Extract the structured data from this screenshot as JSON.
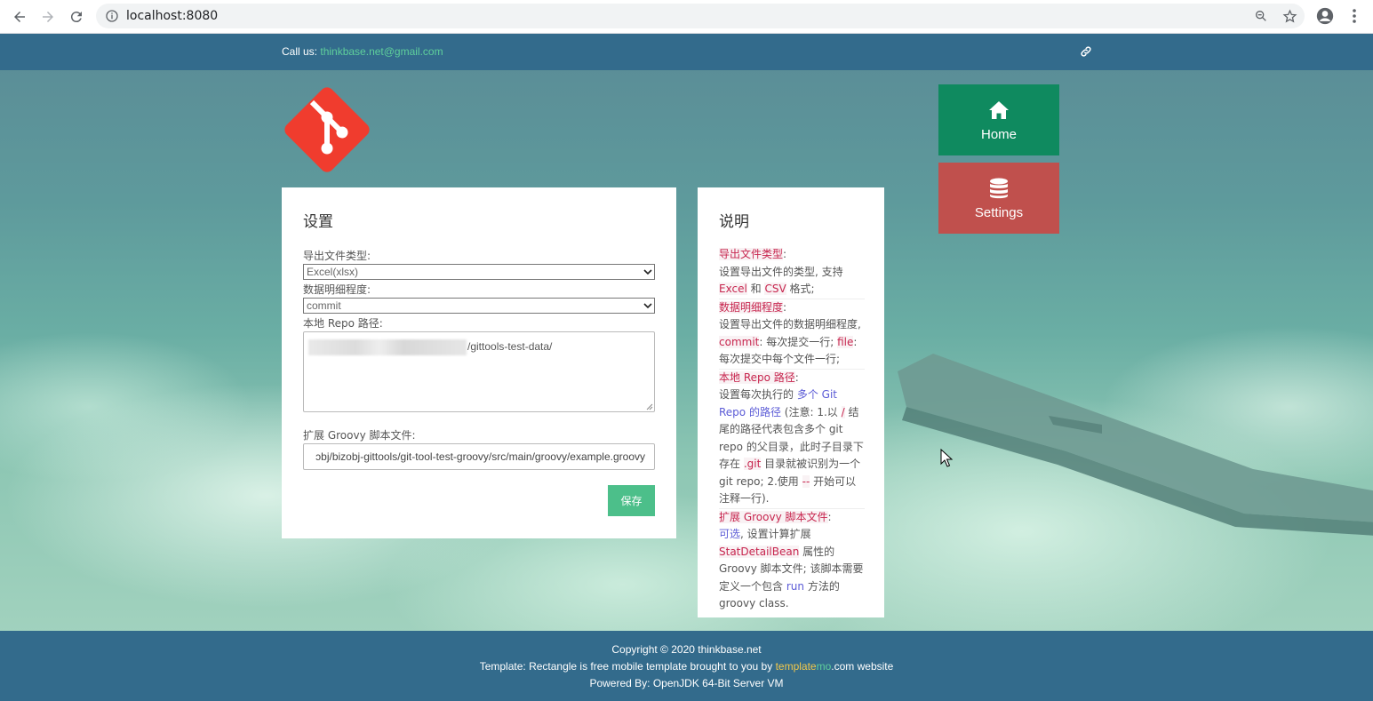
{
  "browser": {
    "url": "localhost:8080"
  },
  "topbar": {
    "callus_label": "Call us:",
    "email": "thinkbase.net@gmail.com"
  },
  "tiles": {
    "home_label": "Home",
    "settings_label": "Settings"
  },
  "settings": {
    "title": "设置",
    "export_type_label": "导出文件类型:",
    "export_type_value": "Excel(xlsx)",
    "detail_label": "数据明细程度:",
    "detail_value": "commit",
    "repo_label": "本地 Repo 路径:",
    "repo_value_visible": "/gittools-test-data/",
    "groovy_label": "扩展 Groovy 脚本文件:",
    "groovy_value": "ɔbj/bizobj-gittools/git-tool-test-groovy/src/main/groovy/example.groovy",
    "save_label": "保存"
  },
  "help": {
    "title": "说明",
    "s1_kw": "导出文件类型",
    "s1_colon": ":",
    "s1_text_a": "设置导出文件的类型, 支持",
    "s1_excel": "Excel",
    "s1_and": "和",
    "s1_csv": "CSV",
    "s1_fmt": "格式;",
    "s2_kw": "数据明细程度",
    "s2_colon": ":",
    "s2_text_a": "设置导出文件的数据明细程度,",
    "s2_commit": "commit",
    "s2_text_b": ": 每次提交一行;",
    "s2_file": "file",
    "s2_text_c": ": 每次提交中每个文件一行;",
    "s3_kw": "本地 Repo 路径",
    "s3_colon": ":",
    "s3_text_a": "设置每次执行的",
    "s3_multi": "多个 Git Repo 的路径",
    "s3_text_b": "(注意: 1.以",
    "s3_slash": "/",
    "s3_text_c": "结尾的路径代表包含多个 git repo 的父目录，此时子目录下 存在",
    "s3_git": ".git",
    "s3_text_d": "目录就被识别为一个git repo;",
    "s3_text_e": "2.使用",
    "s3_dash": "--",
    "s3_text_f": "开始可以注释一行).",
    "s4_kw": "扩展 Groovy 脚本文件",
    "s4_colon": ":",
    "s4_optional": "可选",
    "s4_text_a": ", 设置计算扩展",
    "s4_bean": "StatDetailBean",
    "s4_text_b": "属性的 Groovy 脚本文件; 该脚本需要定义一个包含",
    "s4_run": "run",
    "s4_text_c": "方法的 groovy class."
  },
  "footer": {
    "copyright": "Copyright © 2020 thinkbase.net",
    "template_a": "Template: Rectangle is free mobile template brought to you by ",
    "template_tm1": "template",
    "template_tm2": "mo",
    "template_b": ".com website",
    "powered": "Powered By: OpenJDK 64-Bit Server VM"
  },
  "colors": {
    "topbar": "#336b8c",
    "home_tile": "#0f8a5f",
    "settings_tile": "#c0504d",
    "save_button": "#4cbf8a",
    "git_logo": "#f03c2e"
  }
}
